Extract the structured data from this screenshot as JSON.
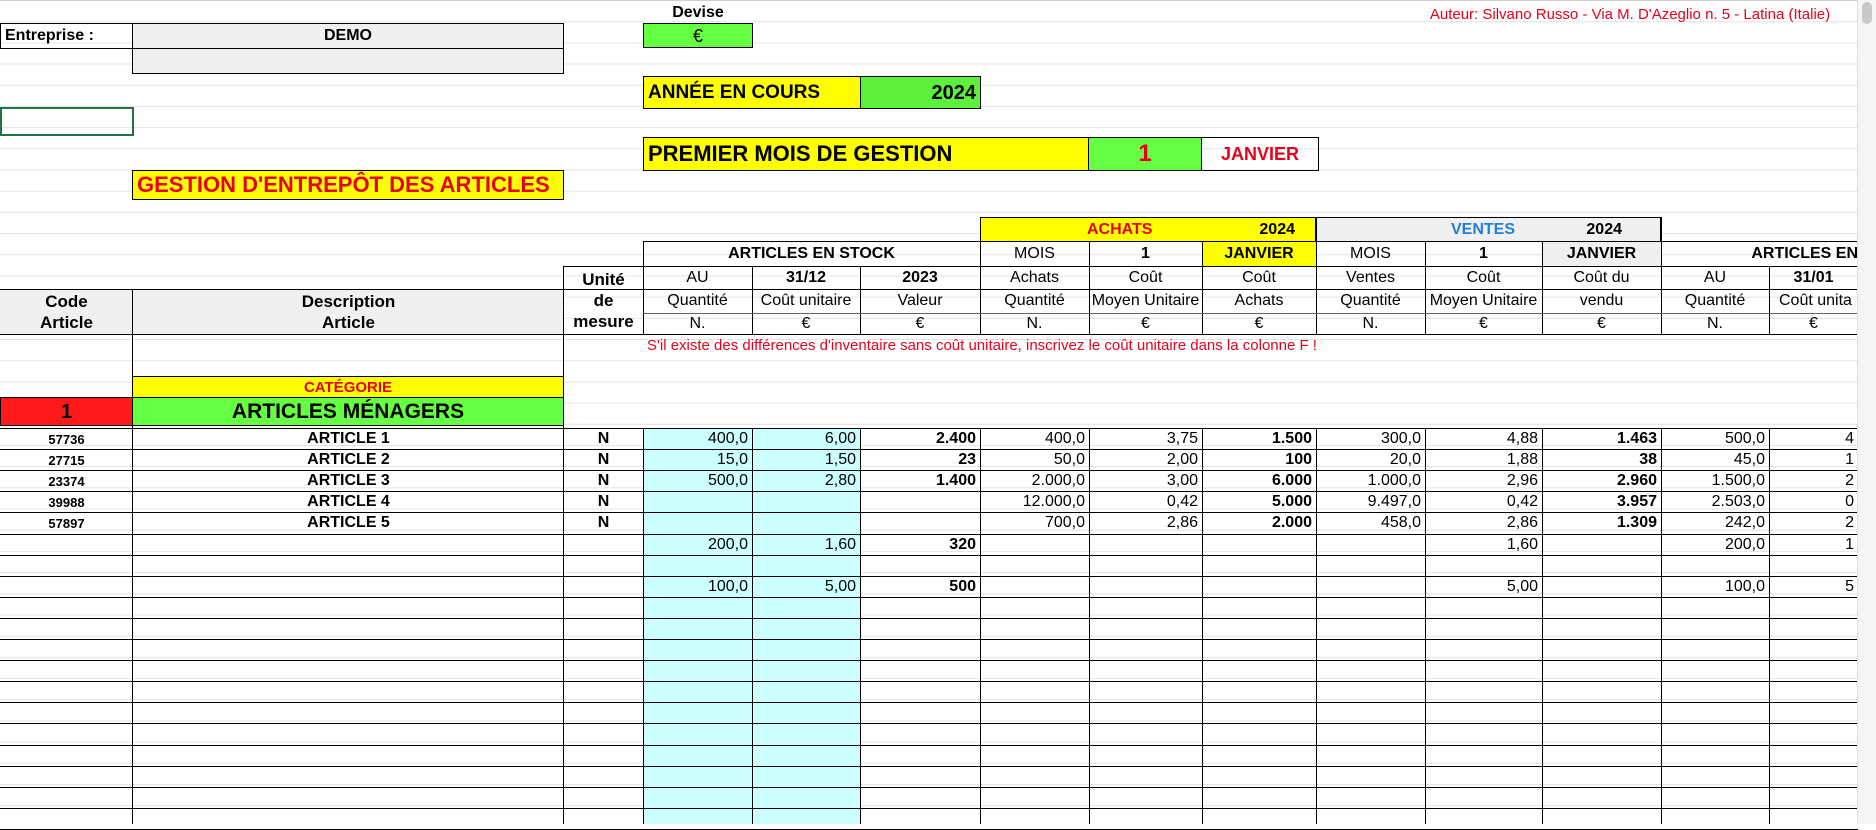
{
  "header": {
    "author": "Auteur: Silvano Russo - Via M. D'Azeglio n. 5 - Latina (Italie)",
    "company_label": "Entreprise :",
    "company_value": "DEMO",
    "currency_label": "Devise",
    "currency_value": "€",
    "current_year_label": "ANNÉE EN COURS",
    "current_year_value": "2024",
    "first_month_label": "PREMIER MOIS DE GESTION",
    "first_month_number": "1",
    "first_month_name": "JANVIER",
    "title": "GESTION D'ENTREPÔT DES ARTICLES"
  },
  "groups": {
    "purchases_label": "ACHATS",
    "purchases_year": "2024",
    "sales_label": "VENTES",
    "sales_year": "2024",
    "stock_label": "ARTICLES EN STOCK",
    "stock_end_label": "ARTICLES EN",
    "mois": "MOIS",
    "mois_num": "1",
    "janvier": "JANVIER"
  },
  "columns": {
    "code": [
      "Code",
      "Article"
    ],
    "description": [
      "Description",
      "Article"
    ],
    "unit": [
      "Unité",
      "de",
      "mesure"
    ],
    "au": "AU",
    "date_3112": "31/12",
    "year_2023": "2023",
    "quantite": "Quantité",
    "cout_unitaire": "Coût unitaire",
    "valeur": "Valeur",
    "achats": "Achats",
    "cout": "Coût",
    "moyen_unitaire": "Moyen Unitaire",
    "ventes": "Ventes",
    "cout_du": "Coût du",
    "vendu": "vendu",
    "date_3101": "31/01",
    "cout_unita": "Coût unita",
    "unit_n": "N.",
    "unit_eur": "€"
  },
  "note": "S'il existe des différences d'inventaire sans coût unitaire, inscrivez le coût unitaire dans la colonne F !",
  "category": {
    "label": "CATÉGORIE",
    "number": "1",
    "name": "ARTICLES MÉNAGERS"
  },
  "rows": [
    {
      "code": "57736",
      "desc": "ARTICLE 1",
      "unit": "N",
      "q": "400,0",
      "cu": "6,00",
      "v": "2.400",
      "aq": "400,0",
      "acu": "3,75",
      "av": "1.500",
      "vq": "300,0",
      "vcu": "4,88",
      "vv": "1.463",
      "sq": "500,0",
      "scu": "4"
    },
    {
      "code": "27715",
      "desc": "ARTICLE 2",
      "unit": "N",
      "q": "15,0",
      "cu": "1,50",
      "v": "23",
      "aq": "50,0",
      "acu": "2,00",
      "av": "100",
      "vq": "20,0",
      "vcu": "1,88",
      "vv": "38",
      "sq": "45,0",
      "scu": "1"
    },
    {
      "code": "23374",
      "desc": "ARTICLE 3",
      "unit": "N",
      "q": "500,0",
      "cu": "2,80",
      "v": "1.400",
      "aq": "2.000,0",
      "acu": "3,00",
      "av": "6.000",
      "vq": "1.000,0",
      "vcu": "2,96",
      "vv": "2.960",
      "sq": "1.500,0",
      "scu": "2"
    },
    {
      "code": "39988",
      "desc": "ARTICLE 4",
      "unit": "N",
      "q": "",
      "cu": "",
      "v": "",
      "aq": "12.000,0",
      "acu": "0,42",
      "av": "5.000",
      "vq": "9.497,0",
      "vcu": "0,42",
      "vv": "3.957",
      "sq": "2.503,0",
      "scu": "0"
    },
    {
      "code": "57897",
      "desc": "ARTICLE 5",
      "unit": "N",
      "q": "",
      "cu": "",
      "v": "",
      "aq": "700,0",
      "acu": "2,86",
      "av": "2.000",
      "vq": "458,0",
      "vcu": "2,86",
      "vv": "1.309",
      "sq": "242,0",
      "scu": "2"
    },
    {
      "code": "",
      "desc": "",
      "unit": "",
      "q": "200,0",
      "cu": "1,60",
      "v": "320",
      "aq": "",
      "acu": "",
      "av": "",
      "vq": "",
      "vcu": "1,60",
      "vv": "",
      "sq": "200,0",
      "scu": "1"
    },
    {
      "code": "",
      "desc": "",
      "unit": "",
      "q": "",
      "cu": "",
      "v": "",
      "aq": "",
      "acu": "",
      "av": "",
      "vq": "",
      "vcu": "",
      "vv": "",
      "sq": "",
      "scu": ""
    },
    {
      "code": "",
      "desc": "",
      "unit": "",
      "q": "100,0",
      "cu": "5,00",
      "v": "500",
      "aq": "",
      "acu": "",
      "av": "",
      "vq": "",
      "vcu": "5,00",
      "vv": "",
      "sq": "100,0",
      "scu": "5"
    }
  ]
}
